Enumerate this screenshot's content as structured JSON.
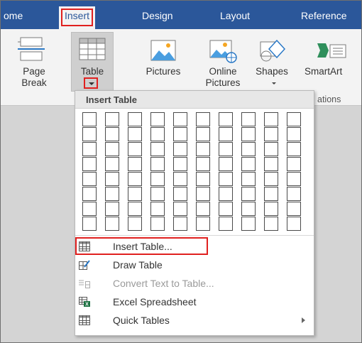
{
  "tabs": [
    {
      "label": "ome",
      "active": false
    },
    {
      "label": "Insert",
      "active": true
    },
    {
      "label": "Design",
      "active": false
    },
    {
      "label": "Layout",
      "active": false
    },
    {
      "label": "Reference",
      "active": false
    }
  ],
  "ribbon": {
    "page_break": {
      "line1": "Page",
      "line2": "Break",
      "icon": "page-break-icon"
    },
    "table": {
      "label": "Table",
      "icon": "table-grid-icon"
    },
    "pictures": {
      "label": "Pictures",
      "icon": "pictures-icon"
    },
    "online_pictures": {
      "line1": "Online",
      "line2": "Pictures",
      "icon": "online-pictures-icon"
    },
    "shapes": {
      "label": "Shapes",
      "icon": "shapes-icon"
    },
    "smartart": {
      "label": "SmartArt",
      "icon": "smartart-icon"
    },
    "group_label": "ations"
  },
  "dropdown": {
    "header": "Insert Table",
    "grid": {
      "columns": 10,
      "rows": 8
    },
    "items": [
      {
        "label": "Insert Table...",
        "icon": "insert-table-icon",
        "enabled": true,
        "highlighted": true,
        "submenu": false
      },
      {
        "label": "Draw Table",
        "icon": "draw-table-icon",
        "enabled": true,
        "highlighted": false,
        "submenu": false
      },
      {
        "label": "Convert Text to Table...",
        "icon": "convert-text-icon",
        "enabled": false,
        "highlighted": false,
        "submenu": false
      },
      {
        "label": "Excel Spreadsheet",
        "icon": "excel-spreadsheet-icon",
        "enabled": true,
        "highlighted": false,
        "submenu": false
      },
      {
        "label": "Quick Tables",
        "icon": "quick-tables-icon",
        "enabled": true,
        "highlighted": false,
        "submenu": true
      }
    ]
  },
  "colors": {
    "tabbar": "#2b579a",
    "ribbon": "#f3f3f3",
    "highlight_box": "#e0201f"
  }
}
